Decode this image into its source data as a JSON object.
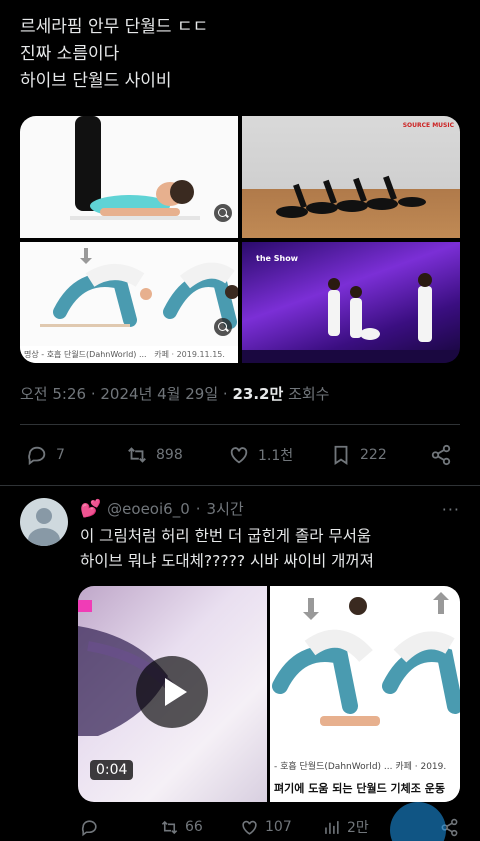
{
  "post": {
    "lines": [
      "르세라핌 안무 단월드 ㄷㄷ",
      "진짜 소름이다",
      "하이브 단월드 사이비"
    ],
    "media": {
      "tile3_caption_title": "명상 - 호흡 단월드(DahnWorld) ...",
      "tile3_caption_source": "카페 · 2019.11.15.",
      "tile2_brand": "SOURCE MUSIC",
      "tile4_stage": "the Show"
    },
    "meta": {
      "time": "오전 5:26",
      "date": "2024년 4월 29일",
      "views_count": "23.2만",
      "views_label": "조회수"
    },
    "actions": {
      "replies": "7",
      "retweets": "898",
      "likes": "1.1천",
      "bookmarks": "222"
    }
  },
  "reply": {
    "handle": "@eoeoi6_0",
    "time": "3시간",
    "lines": [
      "이 그림처럼 허리 한번 더 굽힌게 졸라 무서움",
      "하이브 뭐냐 도대체????? 시바 싸이비 개꺼져"
    ],
    "video_duration": "0:04",
    "media_caption_small": "- 호흡 단월드(DahnWorld) ...  카페 · 2019.",
    "media_caption_large": "펴기에 도움 되는 단월드 기체조 운동",
    "actions": {
      "replies": "",
      "retweets": "66",
      "likes": "107",
      "views": "2만"
    }
  },
  "colors": {
    "background": "#000000",
    "text_primary": "#e7e9ea",
    "text_secondary": "#71767b",
    "divider": "#2f3336",
    "accent": "#1d9bf0"
  },
  "icons": [
    "reply-icon",
    "retweet-icon",
    "like-icon",
    "bookmark-icon",
    "share-icon",
    "views-icon",
    "play-icon",
    "zoom-icon",
    "more-icon"
  ]
}
